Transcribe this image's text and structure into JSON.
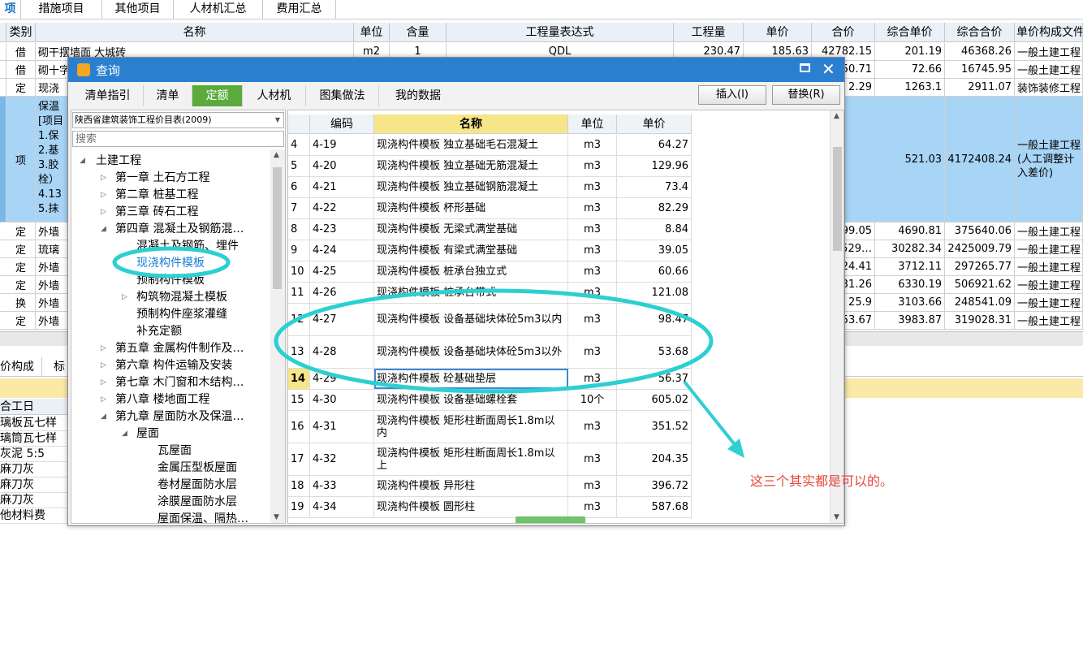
{
  "top_tabs": [
    "项",
    "措施项目",
    "其他项目",
    "人材机汇总",
    "费用汇总"
  ],
  "grid": {
    "headers": [
      "类别",
      "名称",
      "单位",
      "含量",
      "工程量表达式",
      "工程量",
      "单价",
      "合价",
      "综合单价",
      "综合合价",
      "单价构成文件"
    ],
    "rows": [
      [
        "借",
        "砌干摆墙面 大城砖",
        "m2",
        "1",
        "QDL",
        "230.47",
        "185.63",
        "42782.15",
        "201.19",
        "46368.26",
        "一般土建工程"
      ],
      [
        "借",
        "砌十字",
        "",
        "",
        "",
        "",
        "",
        "50.71",
        "72.66",
        "16745.95",
        "一般土建工程"
      ],
      [
        "定",
        "现浇",
        "",
        "",
        "",
        "",
        "",
        "2.29",
        "1263.1",
        "2911.07",
        "装饰装修工程"
      ],
      [
        "项",
        "",
        "",
        "",
        "",
        "",
        "",
        "",
        "521.03",
        "4172408.24",
        ""
      ],
      [
        "定",
        "外墙",
        "",
        "",
        "",
        "",
        "",
        "99.05",
        "4690.81",
        "375640.06",
        "一般土建工程"
      ],
      [
        "定",
        "琉璃",
        "",
        "",
        "",
        "",
        "",
        "529…",
        "30282.34",
        "2425009.79",
        "一般土建工程"
      ],
      [
        "定",
        "外墙",
        "",
        "",
        "",
        "",
        "",
        "24.41",
        "3712.11",
        "297265.77",
        "一般土建工程"
      ],
      [
        "定",
        "外墙",
        "",
        "",
        "",
        "",
        "",
        "31.26",
        "6330.19",
        "506921.62",
        "一般土建工程"
      ],
      [
        "换",
        "外墙",
        "",
        "",
        "",
        "",
        "",
        "25.9",
        "3103.66",
        "248541.09",
        "一般土建工程"
      ],
      [
        "定",
        "外墙",
        "",
        "",
        "",
        "",
        "",
        "53.67",
        "3983.87",
        "319028.31",
        "一般土建工程"
      ]
    ],
    "item_row_name": [
      "保温",
      "[项目",
      "1.保",
      "2.基",
      "3.胶",
      "栓）",
      "4.13",
      "5.抹"
    ],
    "item_row_unit_text": [
      "一般土建工程",
      "(人工调整计",
      "入差价)"
    ]
  },
  "bottom": {
    "tabs": [
      "价构成",
      "标"
    ],
    "col_header": "合工日",
    "items": [
      "璃板瓦七样",
      "璃筒瓦七样",
      "灰泥 5:5",
      "麻刀灰",
      "麻刀灰",
      "麻刀灰",
      "他材料费"
    ]
  },
  "dialog": {
    "title": "查询",
    "tabs": [
      "清单指引",
      "清单",
      "定额",
      "人材机",
      "图集做法",
      "我的数据"
    ],
    "active_tab": "定额",
    "insert_button": "插入(I)",
    "replace_button": "替换(R)",
    "catalog_select": "陕西省建筑装饰工程价目表(2009)",
    "search_placeholder": "搜索",
    "tree": [
      {
        "label": "土建工程",
        "level": 0,
        "state": "open"
      },
      {
        "label": "第一章  土石方工程",
        "level": 1,
        "state": "closed"
      },
      {
        "label": "第二章  桩基工程",
        "level": 1,
        "state": "closed"
      },
      {
        "label": "第三章  砖石工程",
        "level": 1,
        "state": "closed"
      },
      {
        "label": "第四章  混凝土及钢筋混…",
        "level": 1,
        "state": "open"
      },
      {
        "label": "混凝土及钢筋、埋件",
        "level": 2,
        "state": "none"
      },
      {
        "label": "现浇构件模板",
        "level": 2,
        "state": "none",
        "selected": true
      },
      {
        "label": "预制构件模板",
        "level": 2,
        "state": "none"
      },
      {
        "label": "构筑物混凝土模板",
        "level": 2,
        "state": "closed"
      },
      {
        "label": "预制构件座浆灌缝",
        "level": 2,
        "state": "none"
      },
      {
        "label": "补充定额",
        "level": 2,
        "state": "none"
      },
      {
        "label": "第五章  金属构件制作及…",
        "level": 1,
        "state": "closed"
      },
      {
        "label": "第六章  构件运输及安装",
        "level": 1,
        "state": "closed"
      },
      {
        "label": "第七章  木门窗和木结构…",
        "level": 1,
        "state": "closed"
      },
      {
        "label": "第八章  楼地面工程",
        "level": 1,
        "state": "closed"
      },
      {
        "label": "第九章  屋面防水及保温…",
        "level": 1,
        "state": "open"
      },
      {
        "label": "屋面",
        "level": 2,
        "state": "open"
      },
      {
        "label": "瓦屋面",
        "level": 3,
        "state": "none"
      },
      {
        "label": "金属压型板屋面",
        "level": 3,
        "state": "none"
      },
      {
        "label": "卷材屋面防水层",
        "level": 3,
        "state": "none"
      },
      {
        "label": "涂膜屋面防水层",
        "level": 3,
        "state": "none"
      },
      {
        "label": "屋面保温、隔热…",
        "level": 3,
        "state": "none"
      }
    ],
    "list_headers": [
      "编码",
      "名称",
      "单位",
      "单价"
    ],
    "list_rows": [
      {
        "no": "4",
        "code": "4-19",
        "name": "现浇构件模板 独立基础毛石混凝土",
        "unit": "m3",
        "price": "64.27"
      },
      {
        "no": "5",
        "code": "4-20",
        "name": "现浇构件模板 独立基础无筋混凝土",
        "unit": "m3",
        "price": "129.96"
      },
      {
        "no": "6",
        "code": "4-21",
        "name": "现浇构件模板 独立基础钢筋混凝土",
        "unit": "m3",
        "price": "73.4"
      },
      {
        "no": "7",
        "code": "4-22",
        "name": "现浇构件模板 杯形基础",
        "unit": "m3",
        "price": "82.29"
      },
      {
        "no": "8",
        "code": "4-23",
        "name": "现浇构件模板 无梁式满堂基础",
        "unit": "m3",
        "price": "8.84"
      },
      {
        "no": "9",
        "code": "4-24",
        "name": "现浇构件模板 有梁式满堂基础",
        "unit": "m3",
        "price": "39.05"
      },
      {
        "no": "10",
        "code": "4-25",
        "name": "现浇构件模板 桩承台独立式",
        "unit": "m3",
        "price": "60.66"
      },
      {
        "no": "11",
        "code": "4-26",
        "name": "现浇构件模板 桩承台带式",
        "unit": "m3",
        "price": "121.08"
      },
      {
        "no": "12",
        "code": "4-27",
        "name": "现浇构件模板 设备基础块体砼5m3以内",
        "unit": "m3",
        "price": "98.47"
      },
      {
        "no": "13",
        "code": "4-28",
        "name": "现浇构件模板 设备基础块体砼5m3以外",
        "unit": "m3",
        "price": "53.68"
      },
      {
        "no": "14",
        "code": "4-29",
        "name": "现浇构件模板 砼基础垫层",
        "unit": "m3",
        "price": "56.37"
      },
      {
        "no": "15",
        "code": "4-30",
        "name": "现浇构件模板 设备基础螺栓套",
        "unit": "10个",
        "price": "605.02"
      },
      {
        "no": "16",
        "code": "4-31",
        "name": "现浇构件模板 矩形柱断面周长1.8m以内",
        "unit": "m3",
        "price": "351.52"
      },
      {
        "no": "17",
        "code": "4-32",
        "name": "现浇构件模板 矩形柱断面周长1.8m以上",
        "unit": "m3",
        "price": "204.35"
      },
      {
        "no": "18",
        "code": "4-33",
        "name": "现浇构件模板 异形柱",
        "unit": "m3",
        "price": "396.72"
      },
      {
        "no": "19",
        "code": "4-34",
        "name": "现浇构件模板 圆形柱",
        "unit": "m3",
        "price": "587.68"
      }
    ]
  },
  "annotation": {
    "text": "这三个其实都是可以的。",
    "color": "#e5483a",
    "highlight_color": "#2dcfd2"
  },
  "colors": {
    "title_bar": "#2b7fd0",
    "active_tab": "#5aaa3c",
    "selected_row": "#a8d4f6",
    "tree_selected": "#1a7fd4"
  }
}
